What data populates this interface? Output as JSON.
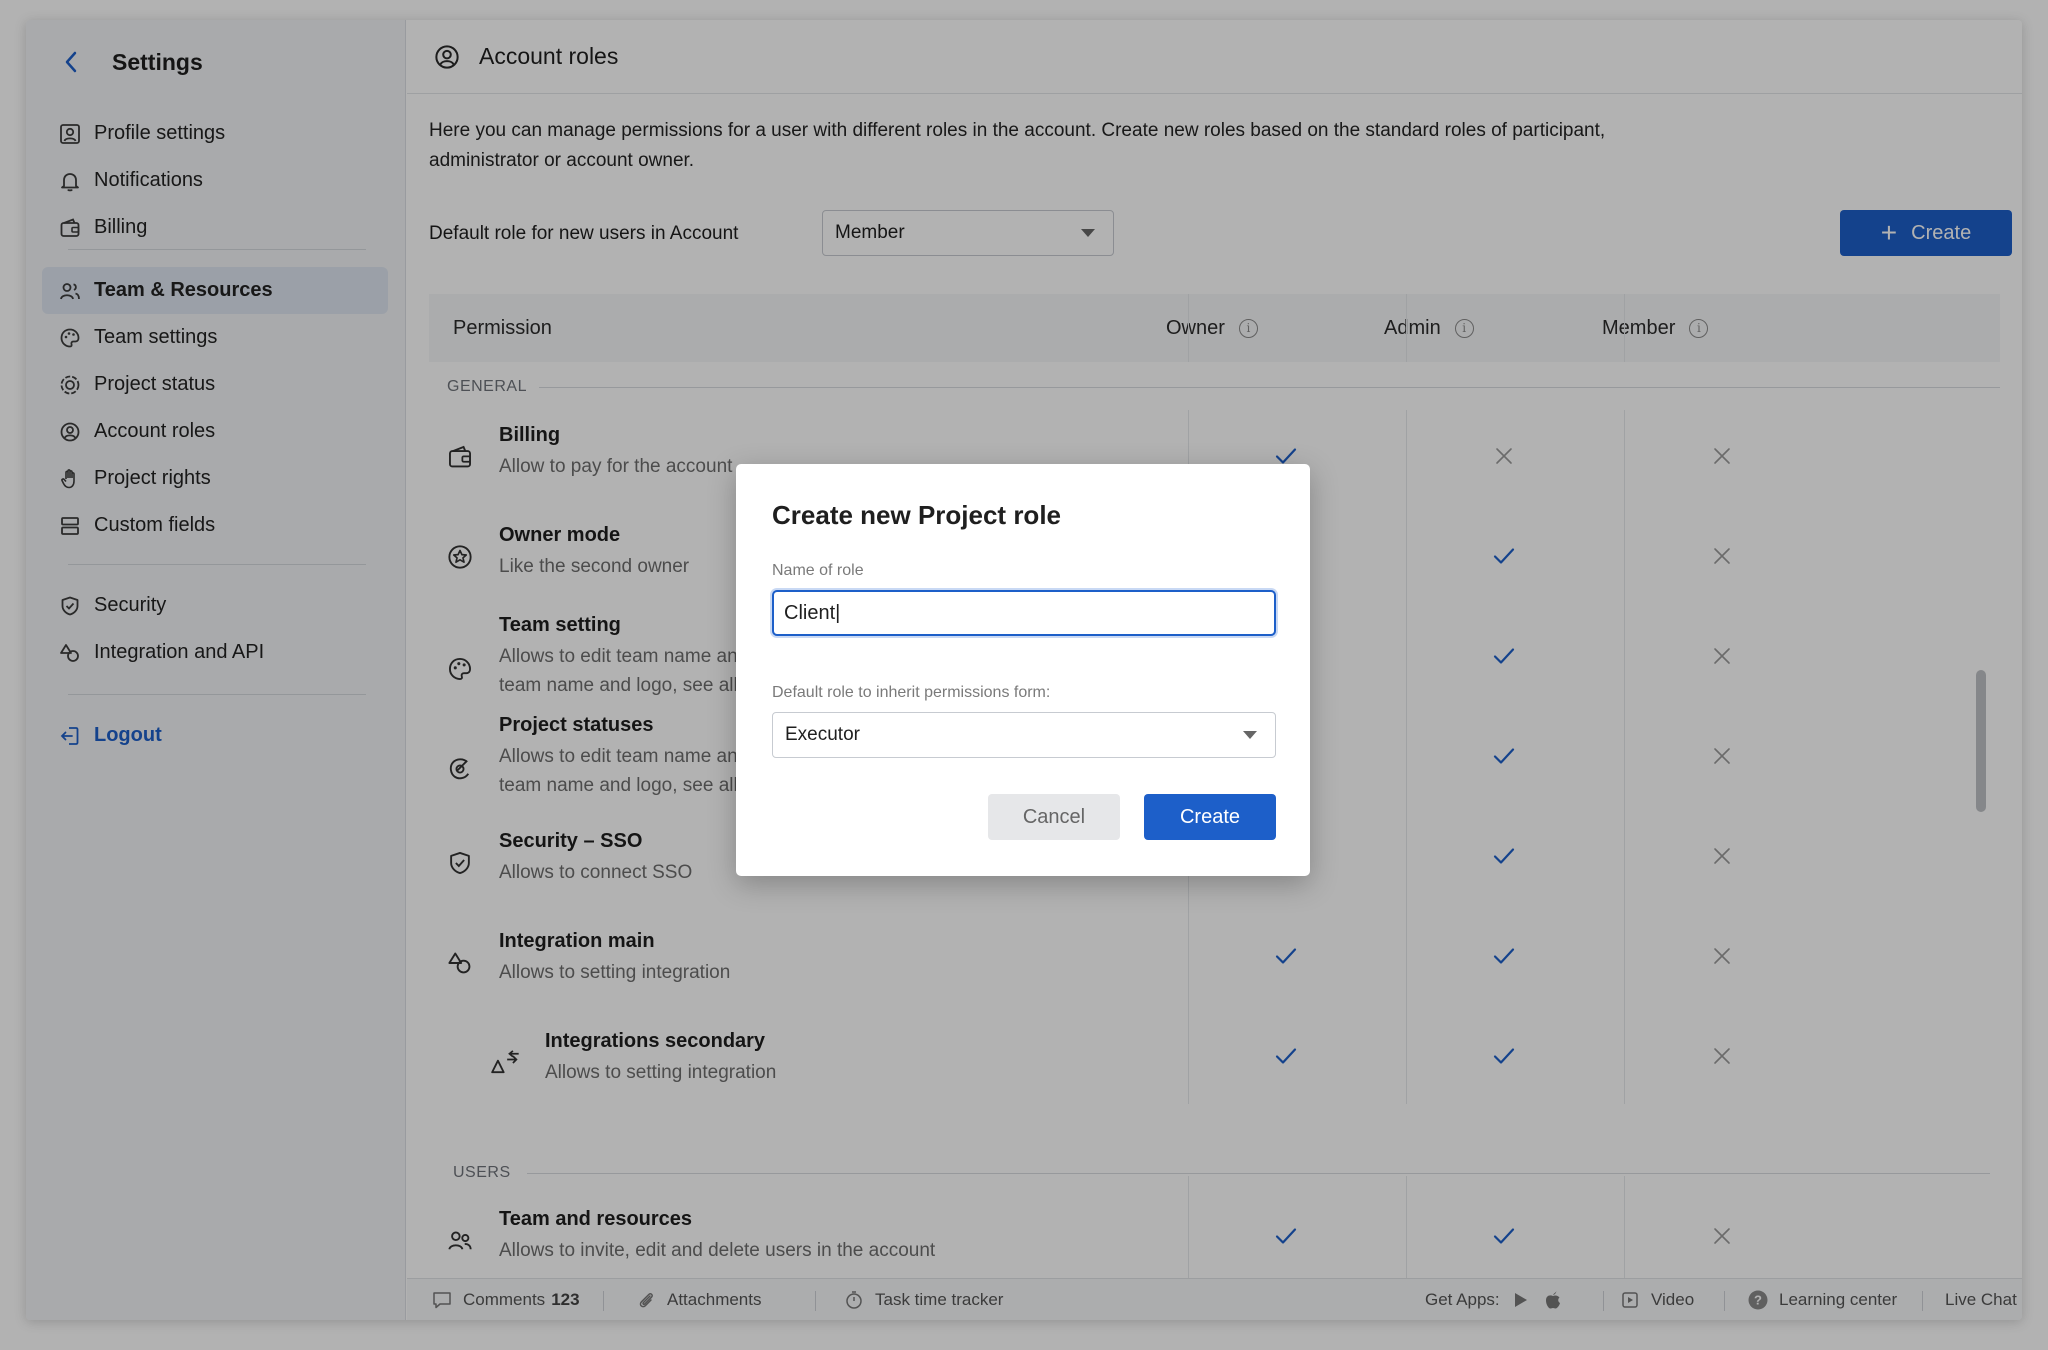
{
  "sidebar": {
    "title": "Settings",
    "group1": [
      {
        "label": "Profile settings",
        "icon": "profile-icon"
      },
      {
        "label": "Notifications",
        "icon": "bell-icon"
      },
      {
        "label": "Billing",
        "icon": "wallet-icon"
      }
    ],
    "group2": [
      {
        "label": "Team & Resources",
        "icon": "team-icon",
        "active": true
      },
      {
        "label": "Team settings",
        "icon": "palette-icon"
      },
      {
        "label": "Project status",
        "icon": "status-icon"
      },
      {
        "label": "Account roles",
        "icon": "user-circle-icon"
      },
      {
        "label": "Project rights",
        "icon": "hand-icon"
      },
      {
        "label": "Custom fields",
        "icon": "fields-icon"
      }
    ],
    "group3": [
      {
        "label": "Security",
        "icon": "shield-icon"
      },
      {
        "label": "Integration and API",
        "icon": "shapes-icon"
      }
    ],
    "logout": "Logout"
  },
  "main": {
    "title": "Account roles",
    "description": "Here you can manage permissions for a user with different roles in the account. Create new roles based on the standard roles of participant, administrator or account owner.",
    "default_role_label": "Default role for new users in Account",
    "default_role_value": "Member",
    "create_label": "Create",
    "table": {
      "headers": {
        "permission": "Permission",
        "owner": "Owner",
        "admin": "Admin",
        "member": "Member"
      },
      "sections": {
        "general": "GENERAL",
        "users": "USERS"
      },
      "rows": [
        {
          "title": "Billing",
          "desc": "Allow to pay for the account",
          "icon": "wallet-icon",
          "owner": true,
          "admin": false,
          "member": false
        },
        {
          "title": "Owner mode",
          "desc": "Like the second owner",
          "icon": "star-circle-icon",
          "owner": true,
          "admin": true,
          "member": false
        },
        {
          "title": "Team setting",
          "desc": "Allows to edit team name and logo, see all team name and logo, see all",
          "desc1": "Allows to edit team name and logo,",
          "desc2": "team name and logo, see all",
          "icon": "palette-icon",
          "owner": true,
          "admin": true,
          "member": false
        },
        {
          "title": "Project statuses",
          "desc1": "Allows to edit team name and logo,",
          "desc2": "team name and logo, see all",
          "icon": "status-icon",
          "owner": true,
          "admin": true,
          "member": false
        },
        {
          "title": "Security – SSO",
          "desc": "Allows to connect SSO",
          "icon": "shield-icon",
          "owner": true,
          "admin": true,
          "member": false
        },
        {
          "title": "Integration main",
          "desc": "Allows to setting integration",
          "icon": "shapes-icon",
          "owner": true,
          "admin": true,
          "member": false
        },
        {
          "title": "Integrations secondary",
          "desc": "Allows to setting integration",
          "icon": "sub-shapes-icon",
          "owner": true,
          "admin": true,
          "member": false
        },
        {
          "title": "Team and resources",
          "desc": "Allows to invite, edit and delete users in the account",
          "icon": "users-icon",
          "owner": true,
          "admin": true,
          "member": false
        }
      ]
    }
  },
  "footer": {
    "comments_label": "Comments",
    "comments_count": "123",
    "attachments": "Attachments",
    "tracker": "Task time tracker",
    "get_apps": "Get Apps:",
    "video": "Video",
    "learning": "Learning center",
    "chat": "Live Chat"
  },
  "modal": {
    "title": "Create new Project role",
    "name_label": "Name of role",
    "name_value": "Client|",
    "inherit_label": "Default role to inherit permissions form:",
    "inherit_value": "Executor",
    "cancel": "Cancel",
    "create": "Create"
  },
  "colors": {
    "accent": "#1d5fc9",
    "sidebar_bg": "#f3f4f6",
    "active_bg": "#dfe6f1"
  }
}
